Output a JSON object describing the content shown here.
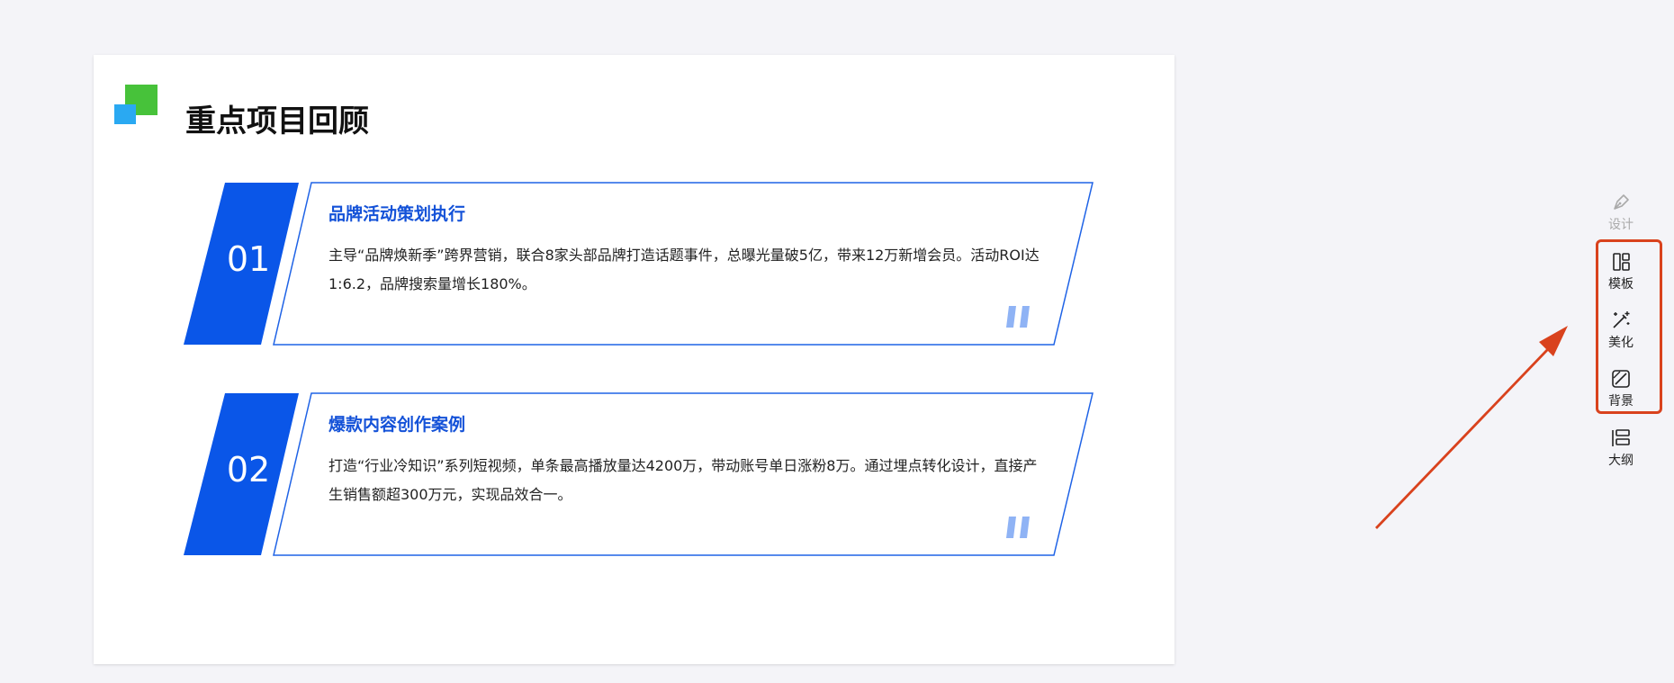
{
  "slide": {
    "title": "重点项目回顾",
    "projects": [
      {
        "number": "01",
        "heading": "品牌活动策划执行",
        "body": "主导“品牌焕新季”跨界营销，联合8家头部品牌打造话题事件，总曝光量破5亿，带来12万新增会员。活动ROI达1:6.2，品牌搜索量增长180%。"
      },
      {
        "number": "02",
        "heading": "爆款内容创作案例",
        "body": "打造“行业冷知识”系列短视频，单条最高播放量达4200万，带动账号单日涨粉8万。通过埋点转化设计，直接产生销售额超300万元，实现品效合一。"
      }
    ]
  },
  "toolbar": {
    "design": {
      "label": "设计",
      "icon": "pen-icon"
    },
    "template": {
      "label": "模板",
      "icon": "layout-grid-icon"
    },
    "beautify": {
      "label": "美化",
      "icon": "magic-wand-icon"
    },
    "background": {
      "label": "背景",
      "icon": "background-slash-icon"
    },
    "outline": {
      "label": "大纲",
      "icon": "outline-list-icon"
    }
  },
  "colors": {
    "accent_blue": "#0a56e8",
    "heading_blue": "#1452d8",
    "logo_green": "#47c23a",
    "logo_blue": "#2aa9f2",
    "highlight_red": "#d9421d"
  }
}
